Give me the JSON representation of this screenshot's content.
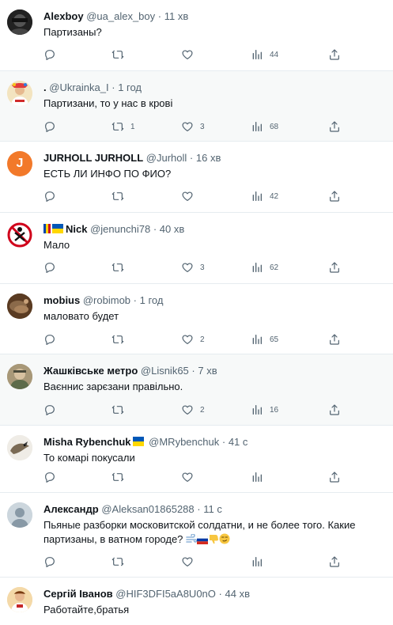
{
  "tweets": [
    {
      "name": "Alexboy",
      "handle": "@ua_alex_boy",
      "time": "11 хв",
      "text": "Партизаны?",
      "replies": "",
      "retweets": "",
      "likes": "",
      "views": "44"
    },
    {
      "name": ".",
      "handle": "@Ukrainka_I",
      "time": "1 год",
      "text": "Партизани, то у нас в крові",
      "replies": "",
      "retweets": "1",
      "likes": "3",
      "views": "68"
    },
    {
      "name": "JURHOLL JURHOLL",
      "handle": "@Jurholl",
      "time": "16 хв",
      "text": "ЕСТЬ ЛИ ИНФО ПО ФИО?",
      "replies": "",
      "retweets": "",
      "likes": "",
      "views": "42"
    },
    {
      "name": "Nick",
      "handle": "@jenunchi78",
      "time": "40 хв",
      "text": "Мало",
      "replies": "",
      "retweets": "",
      "likes": "3",
      "views": "62"
    },
    {
      "name": "mobius",
      "handle": "@robimob",
      "time": "1 год",
      "text": "маловато будет",
      "replies": "",
      "retweets": "",
      "likes": "2",
      "views": "65"
    },
    {
      "name": "Жашківське метро",
      "handle": "@Lisnik65",
      "time": "7 хв",
      "text": "Ваєннис зарєзани правільно.",
      "replies": "",
      "retweets": "",
      "likes": "2",
      "views": "16"
    },
    {
      "name": "Misha Rybenchuk",
      "handle": "@MRybenchuk",
      "time": "41 с",
      "text": "То комарі покусали",
      "replies": "",
      "retweets": "",
      "likes": "",
      "views": ""
    },
    {
      "name": "Александр",
      "handle": "@Aleksan01865288",
      "time": "11 с",
      "text": "Пьяные разборки московитской солдатни, и не более того. Какие партизаны, в ватном городе?",
      "replies": "",
      "retweets": "",
      "likes": "",
      "views": ""
    },
    {
      "name": "Сергій Іванов",
      "handle": "@HIF3DFI5aA8U0nO",
      "time": "44 хв",
      "text": "Работайте,братья",
      "replies": "",
      "retweets": "",
      "likes": "",
      "views": ""
    }
  ],
  "separator": "·",
  "avatar_letter_j": "J",
  "colors": {
    "text": "#0f1419",
    "muted": "#536471",
    "border": "#e6ecf0",
    "alt_bg": "#f7f9f9",
    "j_avatar": "#f2792a"
  },
  "icons": [
    "reply-icon",
    "retweet-icon",
    "like-icon",
    "views-icon",
    "share-icon"
  ]
}
